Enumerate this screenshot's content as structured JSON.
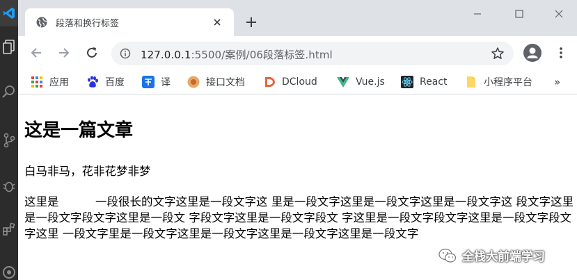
{
  "tab": {
    "title": "段落和换行标签"
  },
  "omnibox": {
    "url_host": "127.0.0.1",
    "url_rest": ":5500/案例/06段落标签.html"
  },
  "bookmarks": [
    {
      "label": "应用",
      "icon": "apps-grid-icon"
    },
    {
      "label": "百度",
      "icon": "baidu-paw-icon"
    },
    {
      "label": "译",
      "icon": "translate-icon"
    },
    {
      "label": "接口文档",
      "icon": "api-doc-icon"
    },
    {
      "label": "DCloud",
      "icon": "dcloud-icon"
    },
    {
      "label": "Vue.js",
      "icon": "vue-icon"
    },
    {
      "label": "React",
      "icon": "react-icon"
    },
    {
      "label": "小程序平台",
      "icon": "folder-icon"
    }
  ],
  "bookmarks_more": "»",
  "page": {
    "heading": "这是一篇文章",
    "paragraph1": "白马非马，花非花梦非梦",
    "paragraph2": "这里是          一段很长的文字这里是一段文字这 里是一段文字这里是一段文字这里是一段文字这 段文字这里是一段文字段文字这里是一段文 字段文字这里是一段文字段文 字这里是一段文字段文字这里是一段文字段文字这里 一段文字里是一段文字这里是一段文字这里是一段文字这里是一段文字"
  },
  "watermark": {
    "text": "全栈大前端学习"
  },
  "colors": {
    "tab_strip": "#dee1e6",
    "omnibox_bg": "#f1f3f4",
    "vscode_bar": "#2c2c2c",
    "vscode_blue": "#0a84ff"
  }
}
